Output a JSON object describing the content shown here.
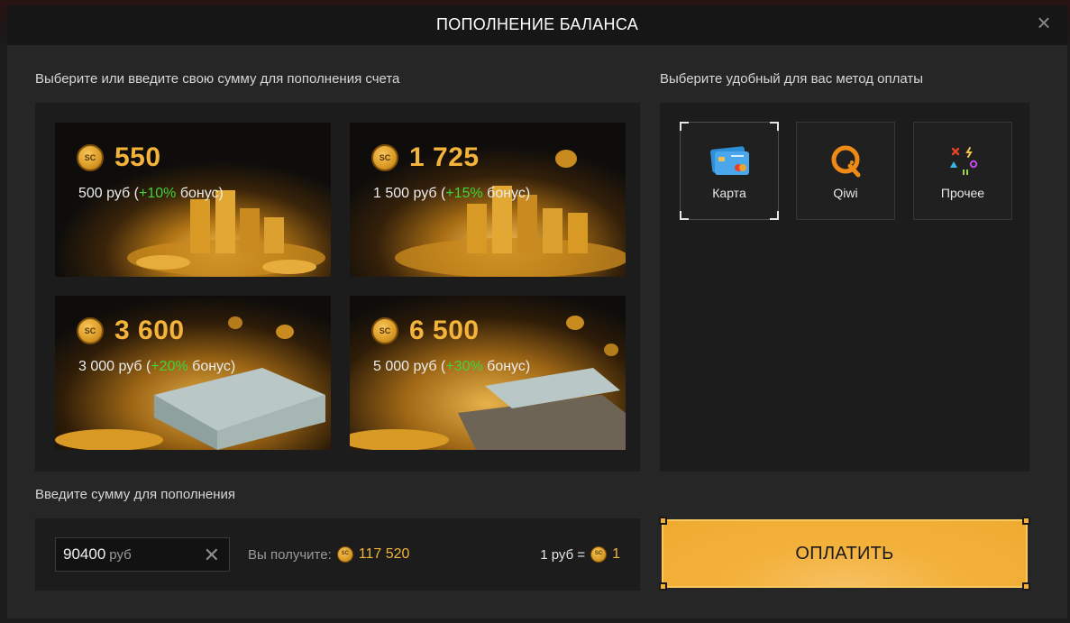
{
  "window": {
    "title": "ПОПОЛНЕНИЕ БАЛАНСА",
    "close_icon": "close-icon"
  },
  "left": {
    "heading": "Выберите или введите свою сумму для пополнения счета",
    "packs": [
      {
        "coins": "550",
        "price": "500 руб",
        "bonus": "+10%",
        "bonus_word": "бонус"
      },
      {
        "coins": "1 725",
        "price": "1 500 руб",
        "bonus": "+15%",
        "bonus_word": "бонус"
      },
      {
        "coins": "3 600",
        "price": "3 000 руб",
        "bonus": "+20%",
        "bonus_word": "бонус"
      },
      {
        "coins": "6 500",
        "price": "5 000 руб",
        "bonus": "+30%",
        "bonus_word": "бонус"
      }
    ],
    "coin_mark": "SC"
  },
  "right": {
    "heading": "Выберите удобный для вас метод оплаты",
    "methods": [
      {
        "label": "Карта",
        "icon": "credit-card-icon",
        "selected": true
      },
      {
        "label": "Qiwi",
        "icon": "qiwi-icon",
        "selected": false
      },
      {
        "label": "Прочее",
        "icon": "other-methods-icon",
        "selected": false
      }
    ]
  },
  "amount": {
    "heading": "Введите сумму для пополнения",
    "value": "90400",
    "unit": "руб",
    "receive_label": "Вы получите:",
    "receive_value": "117 520",
    "rate_label": "1 руб =",
    "rate_value": "1"
  },
  "pay": {
    "label": "ОПЛАТИТЬ"
  },
  "colors": {
    "accent_gold": "#f0b537",
    "bonus_green": "#3fd43b",
    "pay_button": "#f3b13a"
  }
}
